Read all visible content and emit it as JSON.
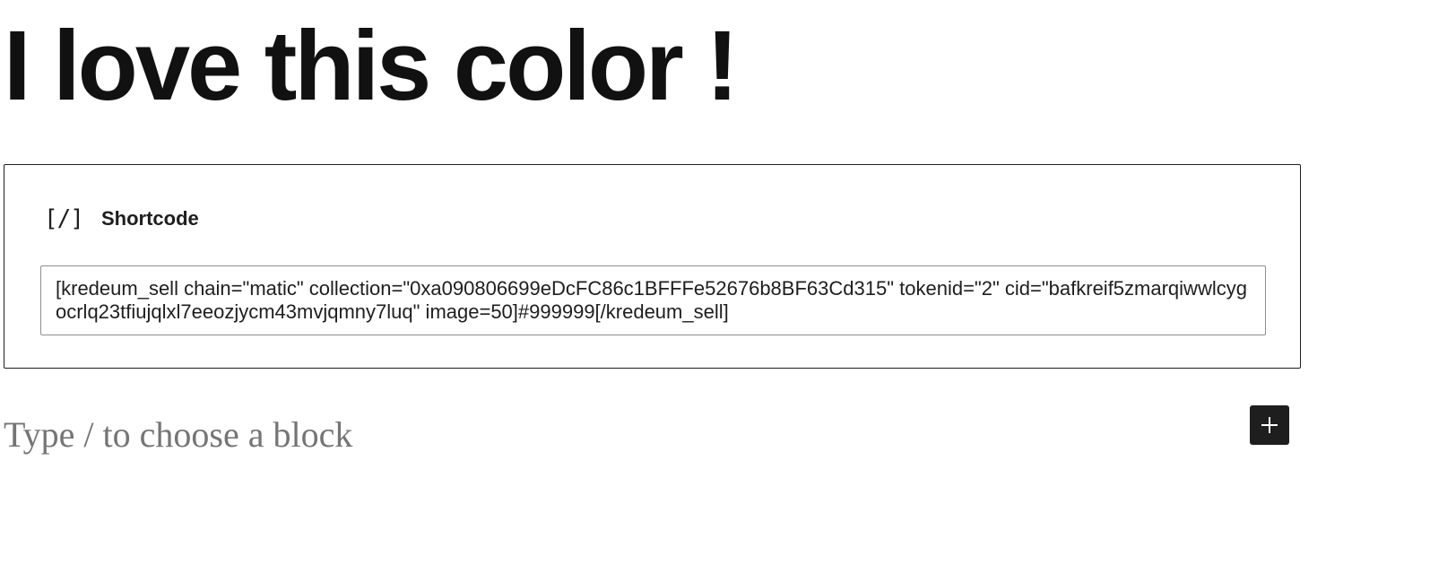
{
  "post": {
    "title": "I love this color !"
  },
  "shortcode_block": {
    "icon": "shortcode-icon",
    "icon_glyph": "[/]",
    "label": "Shortcode",
    "value": "[kredeum_sell chain=\"matic\" collection=\"0xa090806699eDcFC86c1BFFFe52676b8BF63Cd315\" tokenid=\"2\" cid=\"bafkreif5zmarqiwwlcygocrlq23tfiujqlxl7eeozjycm43mvjqmny7luq\" image=50]#999999[/kredeum_sell]"
  },
  "editor": {
    "placeholder": "Type / to choose a block",
    "inserter_icon": "plus-icon"
  }
}
